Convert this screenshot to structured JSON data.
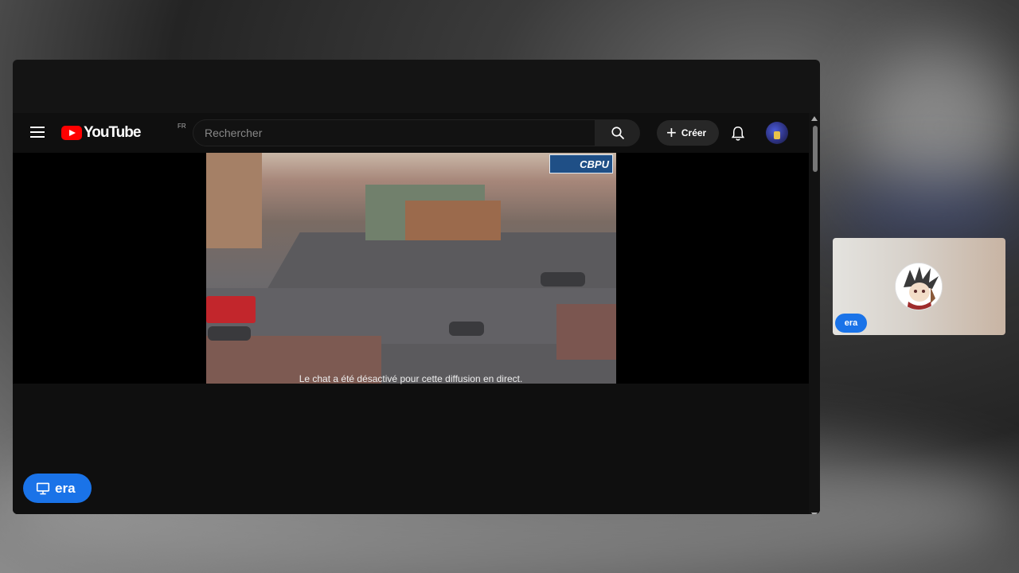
{
  "youtube": {
    "logo_text": "YouTube",
    "country_code": "FR",
    "search_placeholder": "Rechercher",
    "create_label": "Créer",
    "icons": [
      "menu-icon",
      "search-icon",
      "plus-icon",
      "bell-icon",
      "avatar"
    ]
  },
  "video": {
    "overlay_logo": "CBPU"
  },
  "chat": {
    "message": "Le chat a été désactivé pour cette diffusion en direct."
  },
  "meeting": {
    "presenter_name": "era",
    "participant_name": "era",
    "accent_color": "#1a73e8"
  }
}
